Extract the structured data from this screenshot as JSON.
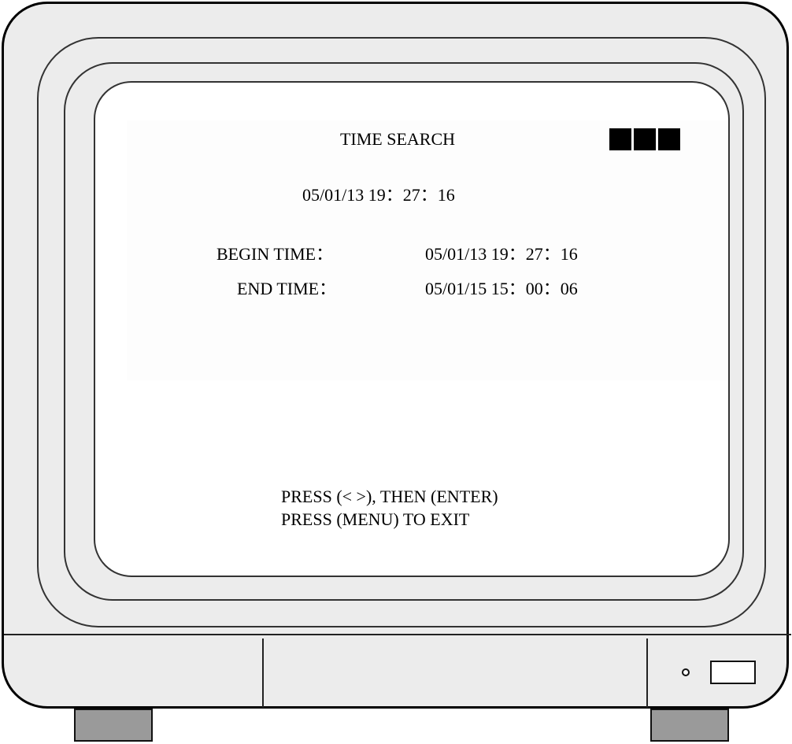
{
  "osd": {
    "title": "TIME SEARCH",
    "current_time": "05/01/13 19：27：16",
    "begin_label": "BEGIN TIME：",
    "begin_value": "05/01/13 19：27：16",
    "end_label": "END TIME：",
    "end_value": "05/01/15 15：00：06",
    "hint_navigate": "PRESS (< >), THEN (ENTER)",
    "hint_exit": "PRESS (MENU) TO EXIT"
  },
  "colors": {
    "bezel": "#ececec",
    "screen": "#ffffff",
    "feet": "#9a9a9a",
    "indicator_blocks": "#000000"
  },
  "icons": {
    "status_blocks": "solid-square-block",
    "led": "power-led-icon",
    "power_button": "power-button"
  }
}
